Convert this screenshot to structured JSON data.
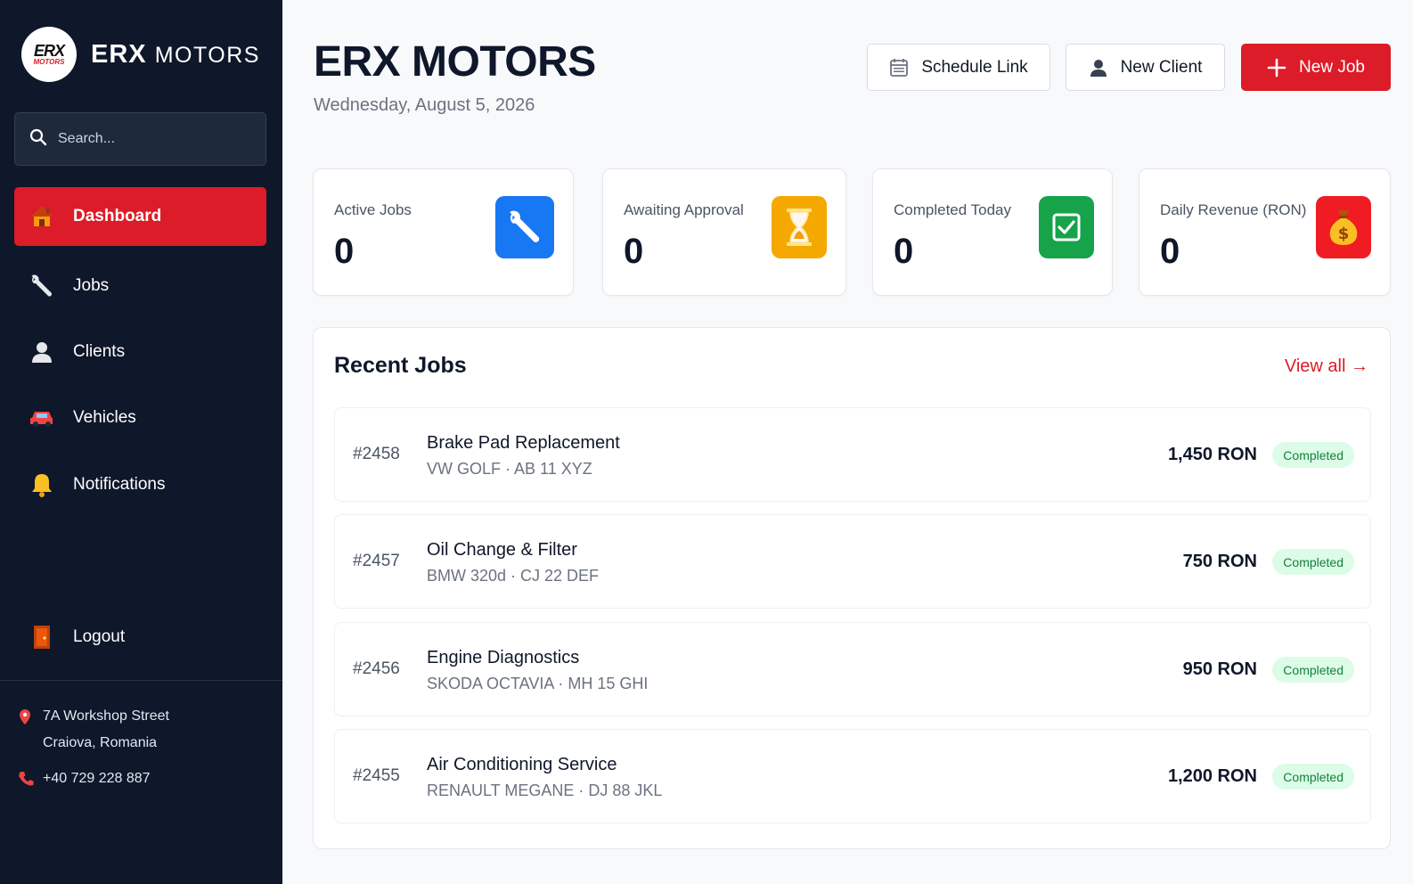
{
  "brand": {
    "logo_line1": "ERX",
    "logo_line2": "MOTORS",
    "name_bold": "ERX",
    "name_thin": "MOTORS"
  },
  "search": {
    "placeholder": "Search..."
  },
  "nav": [
    {
      "label": "Dashboard",
      "icon": "house-icon",
      "active": true
    },
    {
      "label": "Jobs",
      "icon": "wrench-icon"
    },
    {
      "label": "Clients",
      "icon": "user-icon"
    },
    {
      "label": "Vehicles",
      "icon": "car-icon"
    },
    {
      "label": "Notifications",
      "icon": "bell-icon"
    },
    {
      "label": "Logout",
      "icon": "door-icon"
    }
  ],
  "contact": {
    "address_line1": "7A Workshop Street",
    "address_line2": "Craiova, Romania",
    "phone": "+40 729 228 887"
  },
  "header": {
    "title": "ERX MOTORS",
    "date": "Wednesday, August 5, 2026",
    "schedule_label": "Schedule Link",
    "new_client_label": "New Client",
    "new_job_label": "New Job"
  },
  "stats": [
    {
      "label": "Active Jobs",
      "value": "0",
      "icon": "wrench-icon",
      "color": "#1877f2"
    },
    {
      "label": "Awaiting Approval",
      "value": "0",
      "icon": "hourglass-icon",
      "color": "#f5a800"
    },
    {
      "label": "Completed Today",
      "value": "0",
      "icon": "check-icon",
      "color": "#16a34a"
    },
    {
      "label": "Daily Revenue (RON)",
      "value": "0",
      "icon": "money-bag-icon",
      "color": "#ef1c24"
    }
  ],
  "recent_jobs": {
    "title": "Recent Jobs",
    "view_all": "View all →",
    "rows": [
      {
        "id": "#2458",
        "title": "Brake Pad Replacement",
        "vehicle": "VW GOLF · AB 11 XYZ",
        "price": "1,450 RON",
        "status": "Completed"
      },
      {
        "id": "#2457",
        "title": "Oil Change & Filter",
        "vehicle": "BMW 320d · CJ 22 DEF",
        "price": "750 RON",
        "status": "Completed"
      },
      {
        "id": "#2456",
        "title": "Engine Diagnostics",
        "vehicle": "SKODA OCTAVIA · MH 15 GHI",
        "price": "950 RON",
        "status": "Completed"
      },
      {
        "id": "#2455",
        "title": "Air Conditioning Service",
        "vehicle": "RENAULT MEGANE · DJ 88 JKL",
        "price": "1,200 RON",
        "status": "Completed"
      }
    ]
  },
  "colors": {
    "accent": "#dc1c28",
    "sidebar": "#0f172a",
    "success_bg": "#dcfce7",
    "success_text": "#15803d"
  }
}
